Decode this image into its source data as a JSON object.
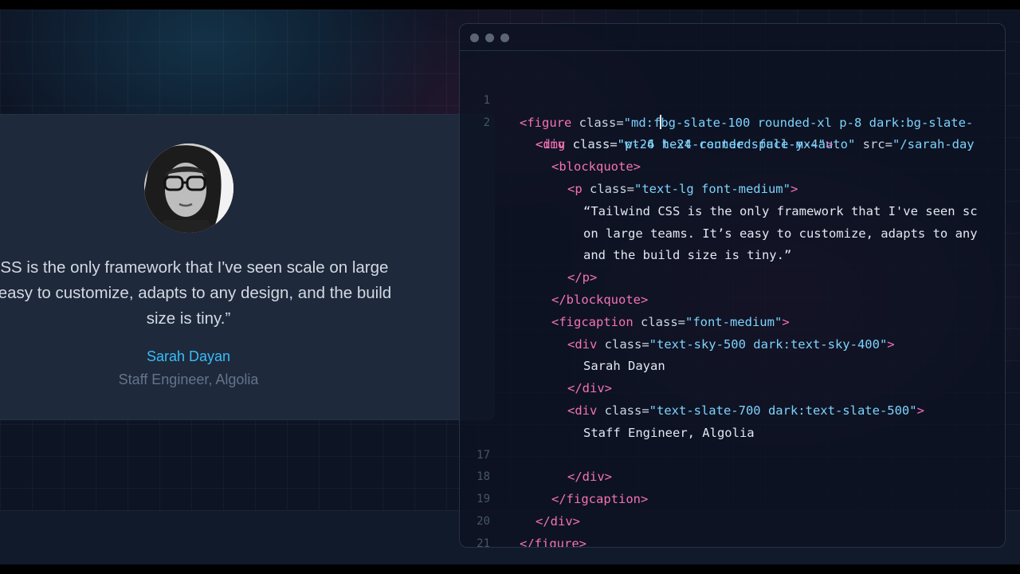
{
  "preview": {
    "quote_lines": [
      "CSS is the only framework that I've seen scale on large",
      "s easy to customize, adapts to any design, and the build",
      "size is tiny.”"
    ],
    "author_name": "Sarah Dayan",
    "author_role": "Staff Engineer, Algolia"
  },
  "editor": {
    "line_numbers": [
      "1",
      "2",
      "",
      "",
      "",
      "",
      "",
      "",
      "",
      "",
      "",
      "",
      "",
      "",
      "",
      "",
      "17",
      "18",
      "19",
      "20",
      "21"
    ],
    "code": {
      "l1": {
        "open": "<figure",
        "attr": " class=",
        "val_a": "\"md:f",
        "val_b": "bg-slate-100 rounded-xl p-8 dark:bg-slate-"
      },
      "l2": {
        "open": "<img",
        "attr": " class=",
        "val": "\"w-24 h-24 rounded-full mx-auto\"",
        "attr2": " src=",
        "val2": "\"/sarah-day"
      },
      "l3": {
        "open": "<div",
        "attr": " class=",
        "val": "\"pt-6 text-center space-y-4\"",
        "close": ">"
      },
      "l4": {
        "tag": "<blockquote>"
      },
      "l5": {
        "open": "<p",
        "attr": " class=",
        "val": "\"text-lg font-medium\"",
        "close": ">"
      },
      "l6": {
        "text": "“Tailwind CSS is the only framework that I've seen sc"
      },
      "l7": {
        "text": "on large teams. It’s easy to customize, adapts to any"
      },
      "l8": {
        "text": "and the build size is tiny.”"
      },
      "l9": {
        "tag": "</p>"
      },
      "l10": {
        "tag": "</blockquote>"
      },
      "l11": {
        "open": "<figcaption",
        "attr": " class=",
        "val": "\"font-medium\"",
        "close": ">"
      },
      "l12": {
        "open": "<div",
        "attr": " class=",
        "val": "\"text-sky-500 dark:text-sky-400\"",
        "close": ">"
      },
      "l13": {
        "text": "Sarah Dayan"
      },
      "l14": {
        "tag": "</div>"
      },
      "l15": {
        "open": "<div",
        "attr": " class=",
        "val": "\"text-slate-700 dark:text-slate-500\"",
        "close": ">"
      },
      "l16": {
        "text": "Staff Engineer, Algolia"
      },
      "l17": {
        "tag": "</div>"
      },
      "l18": {
        "tag": "</figcaption>"
      },
      "l19": {
        "tag": "</div>"
      },
      "l20": {
        "tag": "</figure>"
      }
    }
  },
  "colors": {
    "tag": "#f472b6",
    "attribute_value": "#7dd3fc",
    "author_name": "#38bdf8",
    "author_role": "#64748b"
  }
}
